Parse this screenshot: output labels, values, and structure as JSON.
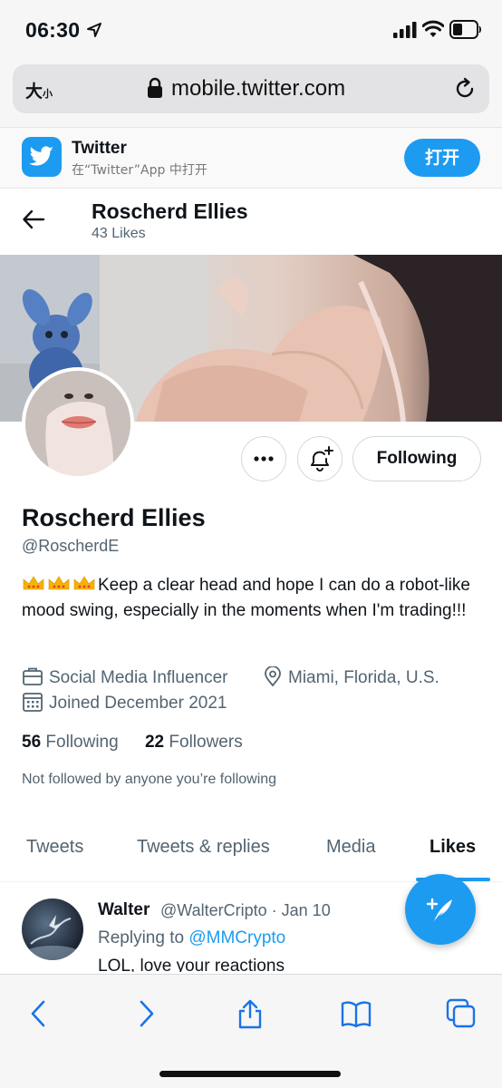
{
  "status_bar": {
    "time": "06:30",
    "icons": [
      "location-arrow-icon",
      "cellular-signal-icon",
      "wifi-icon",
      "battery-icon"
    ]
  },
  "url_bar": {
    "text_size_label": "大",
    "text_size_small": "小",
    "url": "mobile.twitter.com",
    "icons": [
      "lock-icon",
      "reload-icon"
    ]
  },
  "app_banner": {
    "name": "Twitter",
    "subtitle": "在“Twitter”App 中打开",
    "open_label": "打开",
    "icon": "twitter-bird-icon"
  },
  "header": {
    "name": "Roscherd Ellies",
    "likes": "43 Likes",
    "back_icon": "back-arrow-icon"
  },
  "profile": {
    "name": "Roscherd Ellies",
    "handle": "@RoscherdE",
    "bio": "Keep a clear head and hope I can do a robot-like mood swing, especially in the moments when I'm trading!!!",
    "bio_emoji": "crown-icon ×3",
    "category": "Social Media Influencer",
    "location": "Miami, Florida, U.S.",
    "joined": "Joined December 2021",
    "following_count": "56",
    "following_label": "Following",
    "followers_count": "22",
    "followers_label": "Followers",
    "not_followed": "Not followed by anyone you’re following",
    "following_button": "Following"
  },
  "tabs": [
    {
      "label": "Tweets",
      "active": false
    },
    {
      "label": "Tweets & replies",
      "active": false
    },
    {
      "label": "Media",
      "active": false
    },
    {
      "label": "Likes",
      "active": true
    }
  ],
  "tweet": {
    "author": "Walter",
    "handle": "@WalterCripto",
    "separator": "·",
    "date": "Jan 10",
    "replying_prefix": "Replying to",
    "replying_to": "@MMCrypto",
    "text": "LOL, love your reactions"
  },
  "colors": {
    "accent": "#1d9bf0",
    "text_primary": "#0f1419",
    "text_secondary": "#536471"
  },
  "bottom_bar": {
    "icons": [
      "back-icon",
      "forward-icon",
      "share-icon",
      "bookmarks-icon",
      "tabs-icon"
    ]
  }
}
